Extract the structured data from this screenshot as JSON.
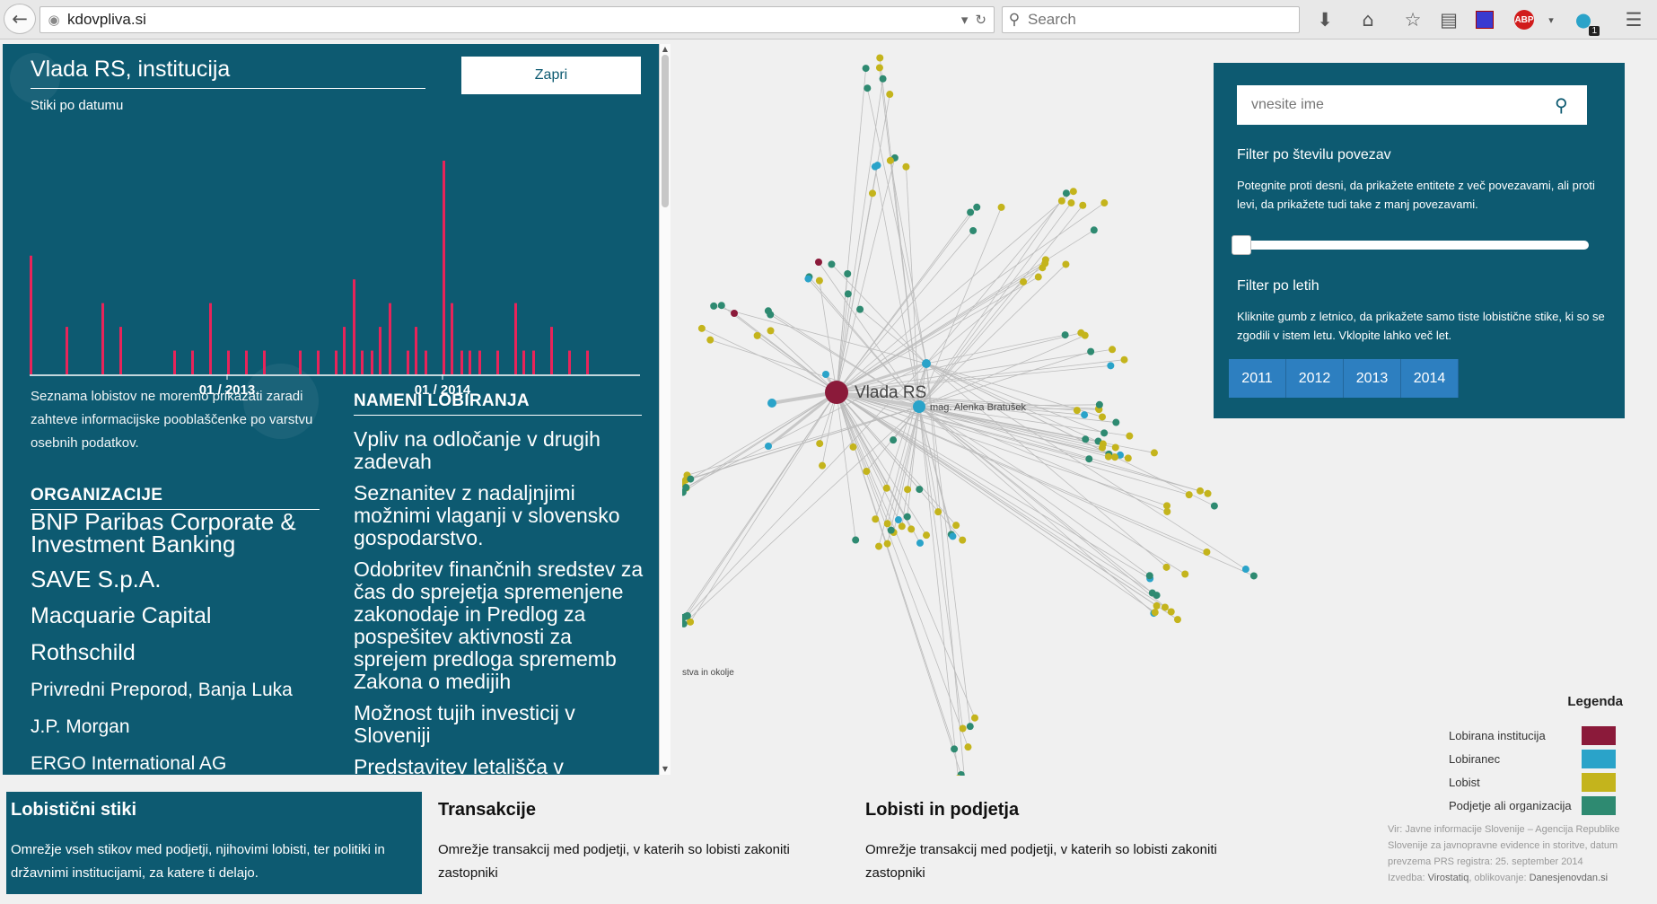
{
  "browser": {
    "url": "kdovpliva.si",
    "search_placeholder": "Search",
    "badge": "1",
    "abp": "ABP"
  },
  "panel": {
    "title": "Vlada RS, institucija",
    "subtitle": "Stiki po datumu",
    "close_label": "Zapri",
    "axis_labels": [
      "01 / 2013",
      "01 / 2014"
    ],
    "privacy_note": "Seznama lobistov ne moremo prikazati zaradi zahteve informacijske pooblaščenke po varstvu osebnih podatkov.",
    "organizations_heading": "ORGANIZACIJE",
    "organizations": [
      "BNP Paribas Corporate & Investment Banking",
      "SAVE S.p.A.",
      "Macquarie Capital",
      "Rothschild",
      "Privredni Preporod, Banja Luka",
      "J.P. Morgan",
      "ERGO International AG"
    ],
    "purposes_heading": "NAMENI LOBIRANJA",
    "purposes": [
      "Vpliv na odločanje v drugih zadevah",
      "Seznanitev z nadaljnjimi možnimi vlaganji v slovensko gospodarstvo.",
      "Odobritev finančnih sredstev za čas do sprejetja spremenjene zakonodaje in Predlog za pospešitev aktivnosti za sprejem predloga sprememb Zakona o medijih",
      "Možnost tujih investicij v Sloveniji",
      "Predstavitev letališča v Benetkah"
    ]
  },
  "chart_data": {
    "type": "bar",
    "title": "Stiki po datumu",
    "tick_labels": [
      "01 / 2013",
      "01 / 2014"
    ],
    "x_domain": [
      "2012-02",
      "2014-12"
    ],
    "ylim": [
      0,
      9
    ],
    "x": [
      "2012-02",
      "2012-04",
      "2012-06",
      "2012-07",
      "2012-10",
      "2012-11",
      "2012-12",
      "2013-01",
      "2013-02",
      "2013-03",
      "2013-05",
      "2013-06",
      "2013-07",
      "2013-07",
      "2013-08",
      "2013-08",
      "2013-09",
      "2013-09",
      "2013-10",
      "2013-11",
      "2013-11",
      "2013-12",
      "2014-01",
      "2014-01",
      "2014-02",
      "2014-02",
      "2014-03",
      "2014-04",
      "2014-05",
      "2014-05",
      "2014-06",
      "2014-07",
      "2014-08",
      "2014-09"
    ],
    "values": [
      5,
      2,
      3,
      2,
      1,
      1,
      3,
      1,
      1,
      1,
      1,
      1,
      1,
      2,
      4,
      1,
      1,
      2,
      3,
      1,
      2,
      1,
      9,
      3,
      1,
      1,
      1,
      1,
      3,
      1,
      1,
      2,
      1,
      1
    ]
  },
  "graph": {
    "center_label": "Vlada RS",
    "node_label": "mag. Alenka Bratušek",
    "partial_label": "stva in okolje"
  },
  "filters": {
    "search_placeholder": "vnesite ime",
    "links_heading": "Filter po številu povezav",
    "links_desc": "Potegnite proti desni, da prikažete entitete z več povezavami, ali proti levi, da prikažete tudi take z manj povezavami.",
    "years_heading": "Filter po letih",
    "years_desc": "Kliknite gumb z letnico, da prikažete samo tiste lobistične stike, ki so se zgodili v istem letu. Vklopite lahko več let.",
    "years": [
      "2011",
      "2012",
      "2013",
      "2014"
    ]
  },
  "legend": {
    "title": "Legenda",
    "items": [
      {
        "label": "Lobirana institucija",
        "color": "#8b1a3a"
      },
      {
        "label": "Lobiranec",
        "color": "#2aa3c9"
      },
      {
        "label": "Lobist",
        "color": "#c4b41c"
      },
      {
        "label": "Podjetje ali organizacija",
        "color": "#2e8a71"
      }
    ]
  },
  "source": {
    "text": "Vir: Javne informacije Slovenije – Agencija Republike Slovenije za javnopravne evidence in storitve, datum prevzema PRS registra: 25. september 2014",
    "credit_prefix": "Izvedba:",
    "credit_1": "Virostatiq",
    "credit_mid": ", oblikovanje:",
    "credit_2": "Danesjenovdan.si"
  },
  "tabs": [
    {
      "title": "Lobistični stiki",
      "desc": "Omrežje vseh stikov med podjetji, njihovimi lobisti, ter politiki in državnimi institucijami, za katere ti delajo."
    },
    {
      "title": "Transakcije",
      "desc": "Omrežje transakcij med podjetji, v katerih so lobisti zakoniti zastopniki"
    },
    {
      "title": "Lobisti in podjetja",
      "desc": "Omrežje transakcij med podjetji, v katerih so lobisti zakoniti zastopniki"
    }
  ],
  "colors": {
    "panel": "#0d5a71",
    "bar": "#e8245a",
    "year_button": "#2d7fc0",
    "edge": "#bcbcbc"
  }
}
